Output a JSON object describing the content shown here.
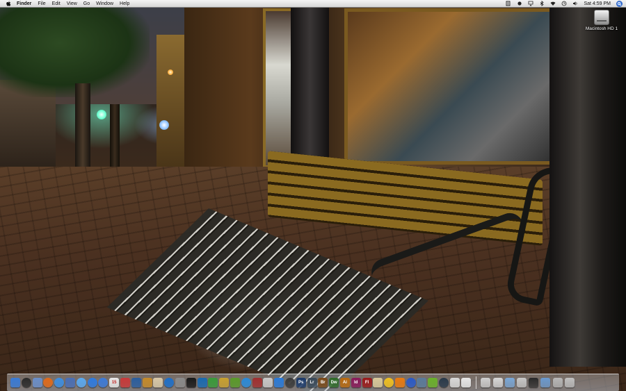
{
  "menubar": {
    "apple_icon": "apple-logo",
    "app_name": "Finder",
    "menus": [
      "File",
      "Edit",
      "View",
      "Go",
      "Window",
      "Help"
    ],
    "status_icons": [
      "script-icon",
      "dot-icon",
      "airplay-icon",
      "bluetooth-icon",
      "wifi-icon",
      "time-machine-icon",
      "volume-icon"
    ],
    "clock": "Sat 4:59 PM",
    "spotlight_icon": "spotlight-icon"
  },
  "desktop": {
    "icons": [
      {
        "label": "Macintosh HD 1",
        "icon": "hard-drive-icon"
      }
    ]
  },
  "dock": {
    "apps": [
      {
        "name": "finder",
        "color": "#3a7bd5",
        "glyph": ""
      },
      {
        "name": "dashboard",
        "color": "#2b2b2b",
        "glyph": "",
        "round": true
      },
      {
        "name": "mail-stamp",
        "color": "#6a8ec8",
        "glyph": ""
      },
      {
        "name": "firefox",
        "color": "#e06a1a",
        "glyph": "",
        "round": true
      },
      {
        "name": "safari",
        "color": "#3d8ee0",
        "glyph": "",
        "round": true
      },
      {
        "name": "xcode",
        "color": "#4a6fb5",
        "glyph": ""
      },
      {
        "name": "ichat",
        "color": "#5aa9f0",
        "glyph": "",
        "round": true
      },
      {
        "name": "ical-globe",
        "color": "#2e7be0",
        "glyph": "",
        "round": true
      },
      {
        "name": "itunes",
        "color": "#3c7ad8",
        "glyph": "",
        "round": true
      },
      {
        "name": "ical",
        "color": "#e8e8e8",
        "glyph": "15"
      },
      {
        "name": "photobooth",
        "color": "#c83a3a",
        "glyph": ""
      },
      {
        "name": "iphoto",
        "color": "#2b5e9e",
        "glyph": ""
      },
      {
        "name": "garageband",
        "color": "#c48a2a",
        "glyph": ""
      },
      {
        "name": "preview",
        "color": "#d8c8a8",
        "glyph": ""
      },
      {
        "name": "quicktime",
        "color": "#1e6fc8",
        "glyph": "",
        "round": true
      },
      {
        "name": "system-prefs",
        "color": "#8a8a8a",
        "glyph": ""
      },
      {
        "name": "terminal",
        "color": "#1a1a1a",
        "glyph": ""
      },
      {
        "name": "aim",
        "color": "#1a6ab0",
        "glyph": ""
      },
      {
        "name": "coda",
        "color": "#3a9a3a",
        "glyph": ""
      },
      {
        "name": "pencil",
        "color": "#c8a030",
        "glyph": ""
      },
      {
        "name": "dreamweaver-old",
        "color": "#5a9a2a",
        "glyph": ""
      },
      {
        "name": "skype",
        "color": "#2a8ad8",
        "glyph": "",
        "round": true
      },
      {
        "name": "fireworks-old",
        "color": "#a03030",
        "glyph": ""
      },
      {
        "name": "transmit",
        "color": "#c8c8c8",
        "glyph": ""
      },
      {
        "name": "app-store",
        "color": "#2a7ad8",
        "glyph": ""
      },
      {
        "name": "activity",
        "color": "#3a3a3a",
        "glyph": "",
        "round": true
      },
      {
        "name": "photoshop",
        "color": "#1d3b6a",
        "glyph": "Ps"
      },
      {
        "name": "lightroom",
        "color": "#3a4a5a",
        "glyph": "Lr"
      },
      {
        "name": "bridge",
        "color": "#7a4a1a",
        "glyph": "Br"
      },
      {
        "name": "dreamweaver",
        "color": "#2f6b2a",
        "glyph": "Dw"
      },
      {
        "name": "illustrator",
        "color": "#b86a10",
        "glyph": "Ai"
      },
      {
        "name": "indesign",
        "color": "#8a1a5a",
        "glyph": "Id"
      },
      {
        "name": "flash",
        "color": "#9a1a1a",
        "glyph": "Fl"
      },
      {
        "name": "address-book",
        "color": "#d8c89a",
        "glyph": ""
      },
      {
        "name": "adium",
        "color": "#f0c020",
        "glyph": "",
        "round": true
      },
      {
        "name": "vlc",
        "color": "#e87a10",
        "glyph": ""
      },
      {
        "name": "world-globe",
        "color": "#2a5ac8",
        "glyph": "",
        "round": true
      },
      {
        "name": "network",
        "color": "#5a7a9a",
        "glyph": ""
      },
      {
        "name": "utorrent",
        "color": "#6ab02a",
        "glyph": ""
      },
      {
        "name": "time-machine",
        "color": "#2a3a4a",
        "glyph": "",
        "round": true
      },
      {
        "name": "grapher",
        "color": "#d8d8d8",
        "glyph": ""
      },
      {
        "name": "textedit",
        "color": "#e8e8e8",
        "glyph": ""
      }
    ],
    "stacks": [
      {
        "name": "magnifier",
        "color": "#d0d0d0"
      },
      {
        "name": "keyboard",
        "color": "#d8d8d8"
      },
      {
        "name": "documents-folder",
        "color": "#7aa8d8"
      },
      {
        "name": "screen",
        "color": "#c8c8c8"
      },
      {
        "name": "monitor",
        "color": "#2a2a2a"
      },
      {
        "name": "downloads",
        "color": "#6a9ad0"
      },
      {
        "name": "disk",
        "color": "#b8b8b8"
      },
      {
        "name": "trash",
        "color": "#c0c0c0"
      }
    ]
  }
}
